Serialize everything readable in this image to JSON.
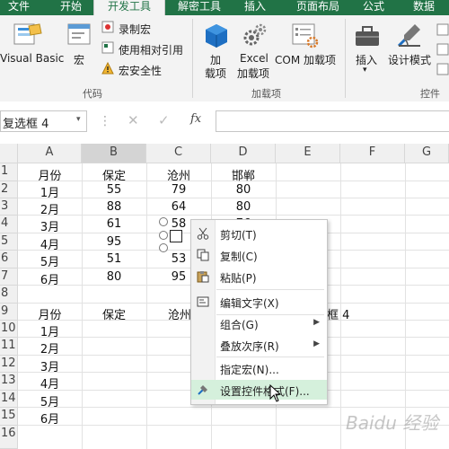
{
  "tabs": [
    {
      "label": "文件",
      "active": false
    },
    {
      "label": "开始",
      "active": false
    },
    {
      "label": "开发工具",
      "active": true
    },
    {
      "label": "解密工具",
      "active": false
    },
    {
      "label": "插入",
      "active": false
    },
    {
      "label": "页面布局",
      "active": false
    },
    {
      "label": "公式",
      "active": false
    },
    {
      "label": "数据",
      "active": false
    }
  ],
  "ribbon": {
    "visual_basic": "Visual Basic",
    "macro": "宏",
    "record_macro": "录制宏",
    "relative_ref": "使用相对引用",
    "macro_security": "宏安全性",
    "group_code": "代码",
    "addins_label_1": "加",
    "addins_label_2": "载项",
    "excel_addins_1": "Excel",
    "excel_addins_2": "加载项",
    "com_addins": "COM 加载项",
    "group_addins": "加载项",
    "insert": "插入",
    "design_mode": "设计模式",
    "group_controls": "控件"
  },
  "formula_bar": {
    "name_box": "复选框 4",
    "fx": "fx"
  },
  "sheet": {
    "columns": [
      "A",
      "B",
      "C",
      "D",
      "E",
      "F",
      "G"
    ],
    "selected_column": "B",
    "rows": [
      "1",
      "2",
      "3",
      "4",
      "5",
      "6",
      "7",
      "8",
      "9",
      "10",
      "11",
      "12",
      "13",
      "14",
      "15",
      "16"
    ],
    "table1": {
      "headers": [
        "月份",
        "保定",
        "沧州",
        "邯郸"
      ],
      "data": [
        [
          "1月",
          "55",
          "79",
          "80"
        ],
        [
          "2月",
          "88",
          "64",
          "80"
        ],
        [
          "3月",
          "61",
          "58",
          "76"
        ],
        [
          "4月",
          "95",
          "",
          ""
        ],
        [
          "5月",
          "51",
          "53",
          ""
        ],
        [
          "6月",
          "80",
          "95",
          ""
        ]
      ]
    },
    "table2": {
      "headers": [
        "月份",
        "保定",
        "沧州"
      ],
      "months": [
        "1月",
        "2月",
        "3月",
        "4月",
        "5月",
        "6月"
      ]
    },
    "e9_text": "框 4"
  },
  "context_menu": {
    "items": [
      {
        "label": "剪切(T)"
      },
      {
        "label": "复制(C)"
      },
      {
        "label": "粘贴(P)"
      },
      {
        "label": "编辑文字(X)"
      },
      {
        "label": "组合(G)"
      },
      {
        "label": "叠放次序(R)"
      },
      {
        "label": "指定宏(N)..."
      },
      {
        "label": "设置控件格式(F)..."
      }
    ]
  },
  "watermark": "Baidu 经验",
  "colors": {
    "excel_green": "#217346",
    "menu_highlight": "#d5f0dc"
  }
}
